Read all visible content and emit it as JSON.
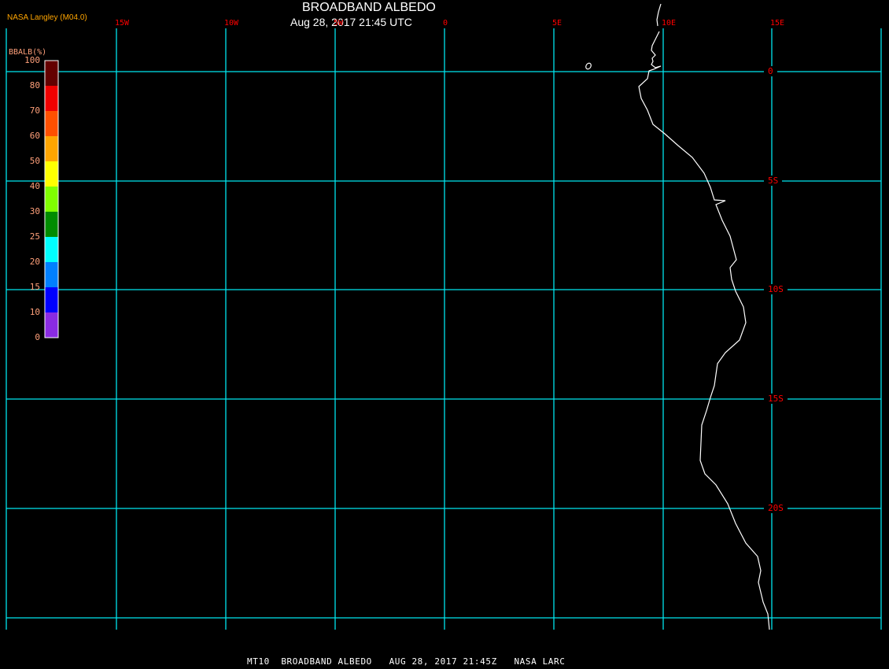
{
  "header": {
    "title": "BROADBAND ALBEDO",
    "subtitle": "Aug 28, 2017 21:45 UTC",
    "source": "NASA Langley (M04.0)"
  },
  "footer": "MT10  BROADBAND ALBEDO   AUG 28, 2017 21:45Z   NASA LARC",
  "map": {
    "longitude_labels": [
      "15W",
      "10W",
      "5W",
      "0",
      "5E",
      "10E",
      "15E"
    ],
    "latitude_labels": [
      "0",
      "5S",
      "10S",
      "15S",
      "20S"
    ],
    "grid_color": "#00e5ee",
    "label_color": "#ff0000",
    "coastline_color": "#ffffff"
  },
  "colorbar": {
    "title": "BBALB(%)",
    "tick_labels": [
      "100",
      "80",
      "70",
      "60",
      "50",
      "40",
      "30",
      "25",
      "20",
      "15",
      "10",
      "0"
    ],
    "colors": [
      "#640000",
      "#f00000",
      "#ff5000",
      "#ffa500",
      "#ffff00",
      "#80ff00",
      "#008c00",
      "#00ffff",
      "#0080ff",
      "#0000ff",
      "#8a2be2"
    ]
  }
}
